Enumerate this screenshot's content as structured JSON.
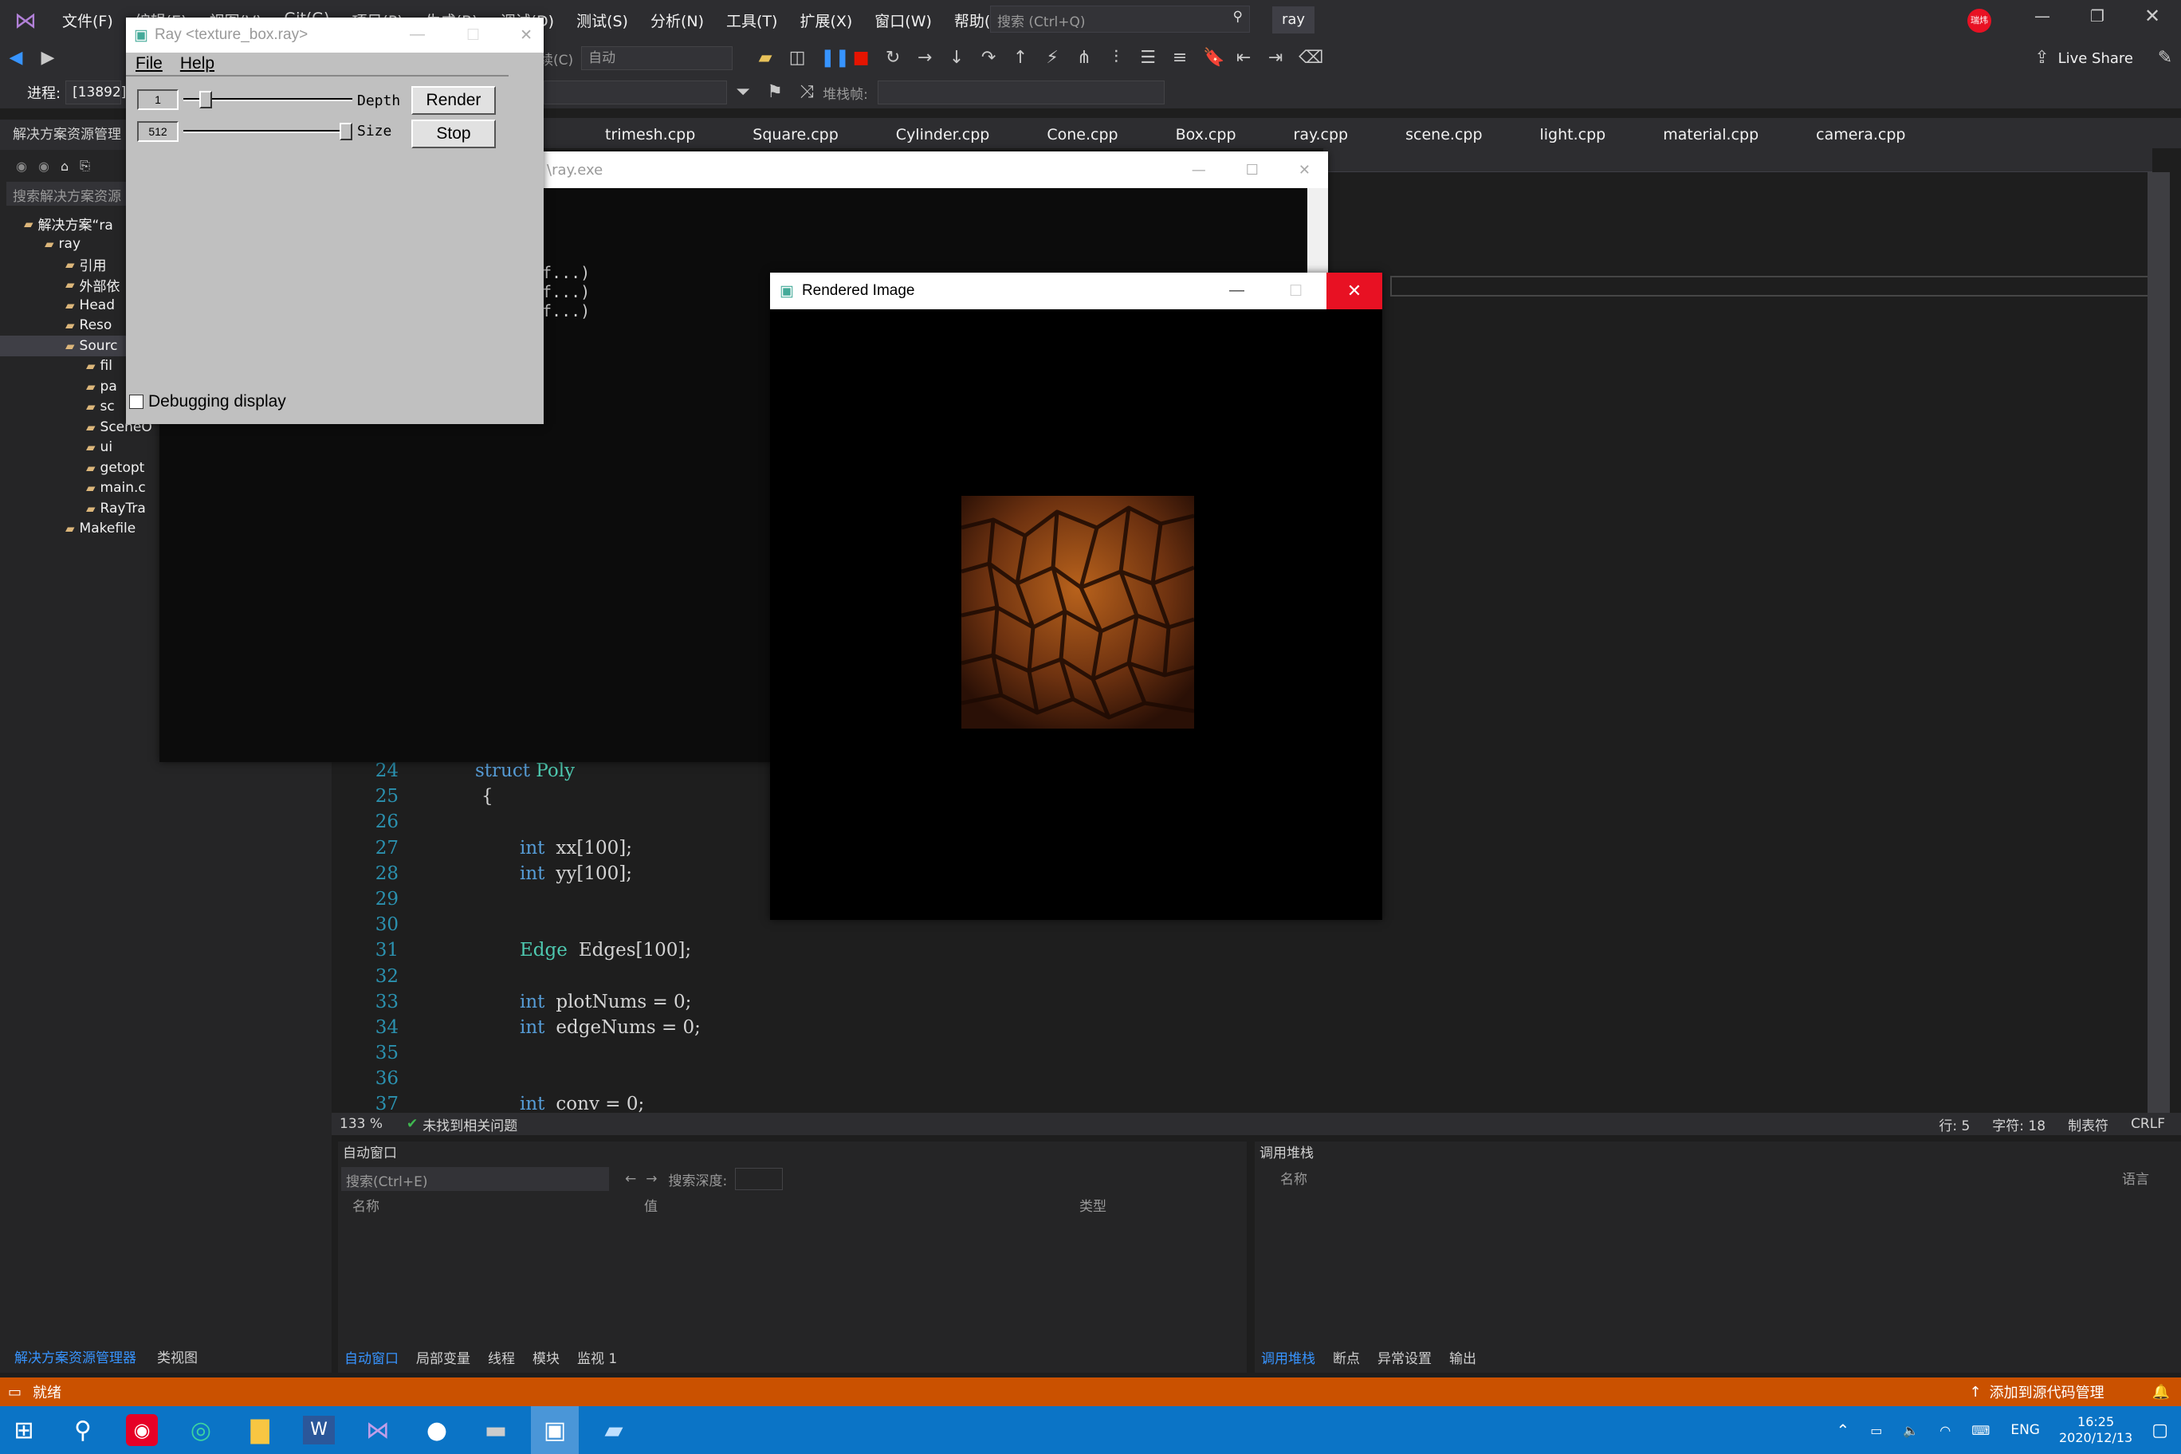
{
  "vs": {
    "menu": [
      "文件(F)",
      "编辑(E)",
      "视图(V)",
      "Git(G)",
      "项目(P)",
      "生成(B)",
      "调试(D)",
      "测试(S)",
      "分析(N)",
      "工具(T)",
      "扩展(X)",
      "窗口(W)",
      "帮助(H)"
    ],
    "search_placeholder": "搜索 (Ctrl+Q)",
    "solution_badge": "ray",
    "user_badge": "瑞炜",
    "live_share": "Live Share",
    "continue_label": "继续(C)",
    "auto_combo": "自动",
    "process_label": "进程:",
    "process_value": "[13892]",
    "stackframe_label": "堆栈帧:",
    "tabs": [
      "trimesh.cpp",
      "Square.cpp",
      "Cylinder.cpp",
      "Cone.cpp",
      "Box.cpp",
      "ray.cpp",
      "scene.cpp",
      "light.cpp",
      "material.cpp",
      "camera.cpp"
    ],
    "solution_explorer": {
      "title": "解决方案资源管理",
      "search": "搜索解决方案资源",
      "items": [
        {
          "label": "解决方案“ra",
          "indent": 0
        },
        {
          "label": "ray",
          "indent": 1
        },
        {
          "label": "引用",
          "indent": 2
        },
        {
          "label": "外部依",
          "indent": 2
        },
        {
          "label": "Head",
          "indent": 2
        },
        {
          "label": "Reso",
          "indent": 2
        },
        {
          "label": "Sourc",
          "indent": 2
        },
        {
          "label": "fil",
          "indent": 3
        },
        {
          "label": "pa",
          "indent": 3
        },
        {
          "label": "sc",
          "indent": 3
        },
        {
          "label": "SceneO",
          "indent": 3
        },
        {
          "label": "ui",
          "indent": 3
        },
        {
          "label": "getopt",
          "indent": 3
        },
        {
          "label": "main.c",
          "indent": 3
        },
        {
          "label": "RayTra",
          "indent": 3
        },
        {
          "label": "Makefile",
          "indent": 2
        }
      ],
      "bottom_tabs": [
        "解决方案资源管理器",
        "类视图"
      ]
    },
    "code_lines": [
      {
        "n": "24",
        "html": "struct Poly",
        "kind": "struct"
      },
      {
        "n": "25",
        "text": "{",
        "kind": "plain"
      },
      {
        "n": "26",
        "text": "",
        "kind": "plain"
      },
      {
        "n": "27",
        "type": "int",
        "rest": "xx[100];",
        "kind": "decl"
      },
      {
        "n": "28",
        "type": "int",
        "rest": "yy[100];",
        "kind": "decl"
      },
      {
        "n": "29",
        "text": "",
        "kind": "plain"
      },
      {
        "n": "30",
        "text": "",
        "kind": "plain"
      },
      {
        "n": "31",
        "type": "Edge",
        "rest": "Edges[100];",
        "kind": "decl2"
      },
      {
        "n": "32",
        "text": "",
        "kind": "plain"
      },
      {
        "n": "33",
        "type": "int",
        "rest": "plotNums = 0;",
        "kind": "decl"
      },
      {
        "n": "34",
        "type": "int",
        "rest": "edgeNums = 0;",
        "kind": "decl"
      },
      {
        "n": "35",
        "text": "",
        "kind": "plain"
      },
      {
        "n": "36",
        "text": "",
        "kind": "plain"
      },
      {
        "n": "37",
        "type": "int",
        "rest": "conv = 0;",
        "kind": "decl"
      }
    ],
    "editor_status": {
      "zoom": "133 %",
      "issues": "未找到相关问题",
      "line": "行: 5",
      "char": "字符: 18",
      "tab": "制表符",
      "eol": "CRLF"
    },
    "auto_window": {
      "title": "自动窗口",
      "search": "搜索(Ctrl+E)",
      "depth": "搜索深度:",
      "cols": [
        "名称",
        "值",
        "类型"
      ],
      "bottom_tabs": [
        "自动窗口",
        "局部变量",
        "线程",
        "模块",
        "监视 1"
      ]
    },
    "call_stack": {
      "title": "调用堆栈",
      "cols": [
        "名称",
        "语言"
      ],
      "bottom_tabs": [
        "调用堆栈",
        "断点",
        "异常设置",
        "输出"
      ]
    },
    "status": {
      "left": "就绪",
      "right": "添加到源代码管理"
    }
  },
  "console": {
    "title": "\\ray.exe",
    "lines": [
      "f...)",
      "f...)",
      "f...)"
    ]
  },
  "ray_window": {
    "title": "Ray <texture_box.ray>",
    "menu": [
      "File",
      "Help"
    ],
    "depth_value": "1",
    "depth_label": "Depth",
    "size_value": "512",
    "size_label": "Size",
    "render": "Render",
    "stop": "Stop",
    "debug": "Debugging display",
    "depth_slider_fraction": 0.1,
    "size_slider_fraction": 1.0
  },
  "rendered": {
    "title": "Rendered Image"
  },
  "taskbar": {
    "lang": "ENG",
    "time": "16:25",
    "date": "2020/12/13"
  },
  "colors": {
    "vs_accent": "#007acc",
    "status_orange": "#ca5100",
    "close_red": "#e81123",
    "taskbar": "#0b74c6"
  }
}
